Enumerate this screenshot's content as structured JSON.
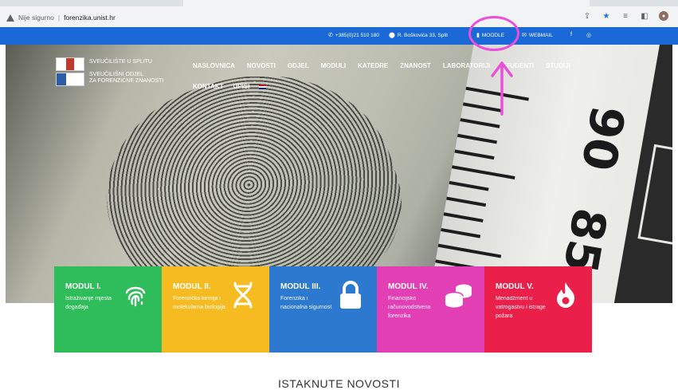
{
  "browser": {
    "security_label": "Nije sigurno",
    "url": "forenzika.unist.hr"
  },
  "topbar": {
    "phone": "+385(0)21 510 180",
    "address": "R. Boškovića 33, Split",
    "moodle": "MOODLE",
    "webmail": "WEBMAIL"
  },
  "logo": {
    "line1": "SVEUČILIŠTE U SPLITU",
    "line2": "SVEUČILIŠNI ODJEL",
    "line3": "ZA FORENZIČNE ZNANOSTI"
  },
  "nav": {
    "items": [
      "NASLOVNICA",
      "NOVOSTI",
      "ODJEL",
      "MODULI",
      "KATEDRE",
      "ZNANOST",
      "LABORATORIJI",
      "STUDENTI",
      "STUDIJI"
    ],
    "items2": [
      "KONTAKT",
      "UPISI"
    ]
  },
  "hero": {
    "ruler_numbers": [
      "90",
      "85"
    ]
  },
  "modules": [
    {
      "title": "MODUL I.",
      "desc": "Istraživanje mjesta događaja",
      "color": "#2ebd5a",
      "icon": "fingerprint-icon"
    },
    {
      "title": "MODUL II.",
      "desc": "Forenzička kemija i molekularna biologija",
      "color": "#f6bb21",
      "icon": "dna-icon"
    },
    {
      "title": "MODUL III.",
      "desc": "Forenzika i nacionalna sigurnost",
      "color": "#2d79cf",
      "icon": "lock-icon"
    },
    {
      "title": "MODUL IV.",
      "desc": "Financijsko računovodstvena forenzika",
      "color": "#e23fb5",
      "icon": "coins-icon"
    },
    {
      "title": "MODUL V.",
      "desc": "Menadžment u vatrogastvu i istrage požara",
      "color": "#ea1f4a",
      "icon": "flame-icon"
    }
  ],
  "news": {
    "title": "ISTAKNUTE NOVOSTI"
  },
  "colors": {
    "topbar": "#1b69d6",
    "annotation": "#ea4fd9"
  }
}
